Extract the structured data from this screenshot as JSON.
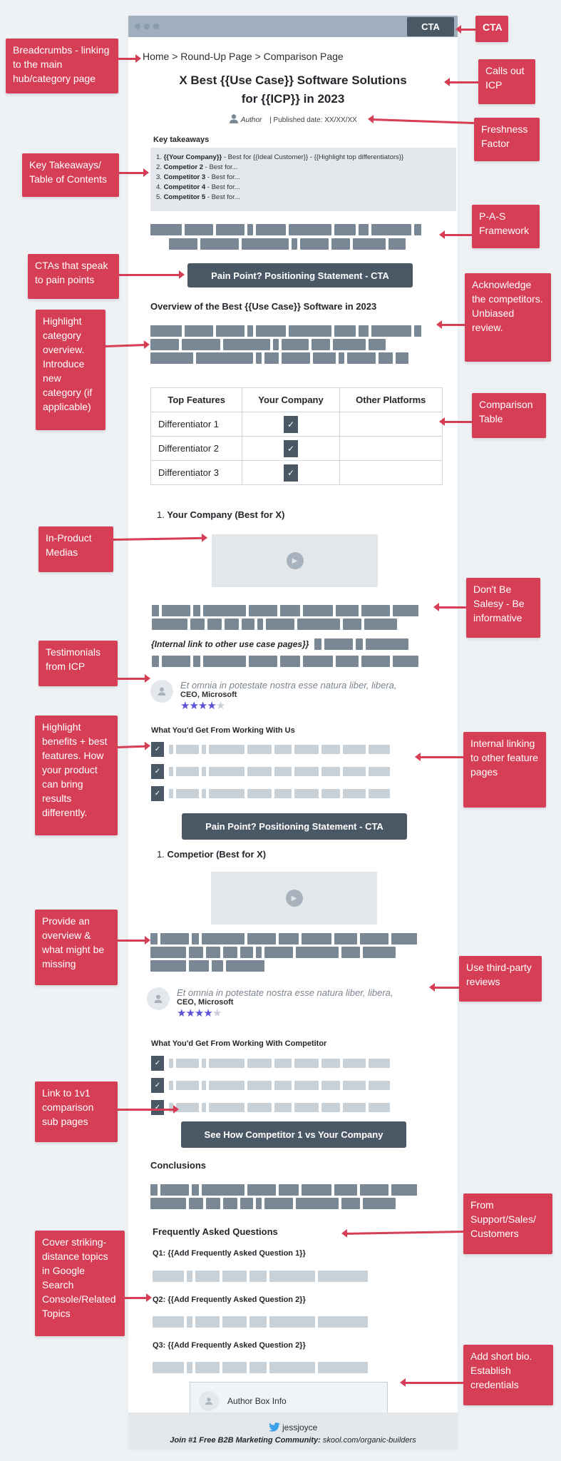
{
  "header": {
    "cta_label": "CTA"
  },
  "breadcrumb": "Home > Round-Up Page  > Comparison Page",
  "title": "X Best {{Use Case}} Software Solutions for {{ICP}} in 2023",
  "byline": {
    "author": "Author",
    "published": "| Published date: XX/XX/XX"
  },
  "key_takeaways": {
    "label": "Key takeaways",
    "items": [
      {
        "num": "1.",
        "name": "{{Your Company}}",
        "rest": " - Best for {{Ideal Customer}} - {{Highlight top differentiators}}"
      },
      {
        "num": "2.",
        "name": "Competior 2",
        "rest": " - Best for..."
      },
      {
        "num": "3.",
        "name": "Competitor 3",
        "rest": " - Best for..."
      },
      {
        "num": "4.",
        "name": "Competitor 4",
        "rest": " - Best for..."
      },
      {
        "num": "5.",
        "name": "Competitor 5",
        "rest": " - Best for..."
      }
    ]
  },
  "cta_pain_point_1": "Pain Point? Positioning Statement - CTA",
  "overview_heading": "Overview of the Best {{Use Case}} Software in 2023",
  "comparison_table": {
    "headers": [
      "Top Features",
      "Your Company",
      "Other Platforms"
    ],
    "rows": [
      {
        "feature": "Differentiator 1",
        "your_company": true,
        "other": false
      },
      {
        "feature": "Differentiator 2",
        "your_company": true,
        "other": false
      },
      {
        "feature": "Differentiator 3",
        "your_company": true,
        "other": false
      }
    ]
  },
  "your_company_section": {
    "heading_num": "1.",
    "heading": "Your Company (Best for X)",
    "internal_link": "{Internal link to other use case pages}}",
    "testimonial": {
      "quote": "Et omnia in potestate nostra esse natura liber, libera,",
      "cite": "CEO, Microsoft",
      "rating": 4,
      "max_rating": 5
    },
    "benefits_heading": "What You'd Get From Working With Us",
    "cta": "Pain Point? Positioning Statement - CTA"
  },
  "competitor_section": {
    "heading_num": "1.",
    "heading": "Competior (Best for X)",
    "testimonial": {
      "quote": "Et omnia in potestate nostra esse natura liber, libera,",
      "cite": "CEO, Microsoft",
      "rating": 4,
      "max_rating": 5
    },
    "benefits_heading": "What You'd Get From Working With Competitor",
    "cta": "See How Competitor 1 vs  Your Company"
  },
  "conclusions_heading": "Conclusions",
  "faq": {
    "heading": "Frequently Asked Questions",
    "questions": [
      "Q1: {{Add Frequently Asked Question 1}}",
      "Q2: {{Add Frequently Asked Question 2}}",
      "Q3: {{Add Frequently Asked Question 2}}"
    ]
  },
  "author_box": "Author Box Info",
  "footer": {
    "handle": "jessjoyce",
    "join_label": "Join #1 Free B2B Marketing Community:",
    "join_link": "skool.com/organic-builders"
  },
  "callouts": {
    "cta": "CTA",
    "breadcrumbs": "Breadcrumbs - linking to the main hub/category page",
    "calls_out_icp": "Calls out ICP",
    "freshness": "Freshness Factor",
    "key_takeaways": "Key Takeaways/ Table of Contents",
    "pas": "P-A-S Framework",
    "ctas_pain": "CTAs that speak to pain points",
    "acknowledge": "Acknowledge the competitors. Unbiased review.",
    "highlight_category": "Highlight category overview. Introduce new category (if applicable)",
    "comparison_table": "Comparison Table",
    "in_product": "In-Product Medias",
    "dont_be_salesy": "Don't Be Salesy - Be informative",
    "testimonials": "Testimonials from ICP",
    "highlight_benefits": "Highlight benefits + best features. How your product can bring results differently.",
    "internal_linking": "Internal linking to other feature pages",
    "provide_overview": "Provide an overview & what might be missing",
    "third_party": "Use third-party reviews",
    "link_1v1": "Link to 1v1 comparison sub pages",
    "from_support": "From Support/Sales/ Customers",
    "cover_topics": "Cover striking-distance topics in Google Search Console/Related Topics",
    "author_bio": "Add short bio. Establish credentials"
  },
  "colors": {
    "callout_red": "#d63e55",
    "cta_dark": "#4a5866",
    "star_purple": "#5b52d6",
    "placeholder_bar": "#7a8794",
    "placeholder_light": "#c8d0d8"
  }
}
